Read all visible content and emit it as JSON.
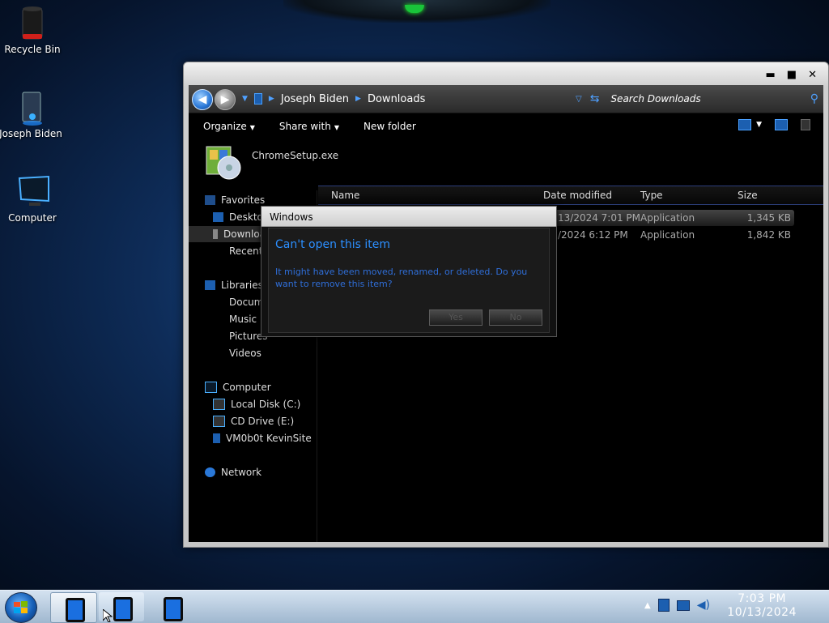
{
  "desktop": {
    "icons": [
      {
        "label": "Recycle Bin",
        "icon": "recycle-bin-icon"
      },
      {
        "label": "Joseph Biden",
        "icon": "user-folder-icon"
      },
      {
        "label": "Computer",
        "icon": "computer-icon"
      }
    ]
  },
  "explorer": {
    "window_controls": {
      "minimize": "▬",
      "maximize": "■",
      "close": "✕"
    },
    "breadcrumb": [
      "Joseph Biden",
      "Downloads"
    ],
    "search_placeholder": "Search Downloads",
    "toolbar": {
      "organize": "Organize",
      "share_with": "Share with",
      "new_folder": "New folder"
    },
    "preview_filename": "ChromeSetup.exe",
    "nav": {
      "favorites": "Favorites",
      "desktop": "Desktop",
      "downloads": "Downloads",
      "recent": "Recent Places",
      "libraries": "Libraries",
      "documents": "Documents",
      "music": "Music",
      "pictures": "Pictures",
      "videos": "Videos",
      "computer": "Computer",
      "local_disk": "Local Disk (C:)",
      "cd_drive": "CD Drive (E:)",
      "share": "VM0b0t KevinSite",
      "network": "Network"
    },
    "columns": {
      "name": "Name",
      "date": "Date modified",
      "type": "Type",
      "size": "Size"
    },
    "files": [
      {
        "date": "13/2024 7:01 PM",
        "type": "Application",
        "size": "1,345 KB"
      },
      {
        "date": "/2024 6:12 PM",
        "type": "Application",
        "size": "1,842 KB"
      }
    ]
  },
  "dialog": {
    "title": "Windows",
    "heading": "Can't open this item",
    "message": "It might have been moved, renamed, or deleted. Do you want to remove this item?",
    "yes": "Yes",
    "no": "No"
  },
  "taskbar": {
    "time": "7:03 PM",
    "date": "10/13/2024",
    "tray_show_hidden": "▲"
  }
}
